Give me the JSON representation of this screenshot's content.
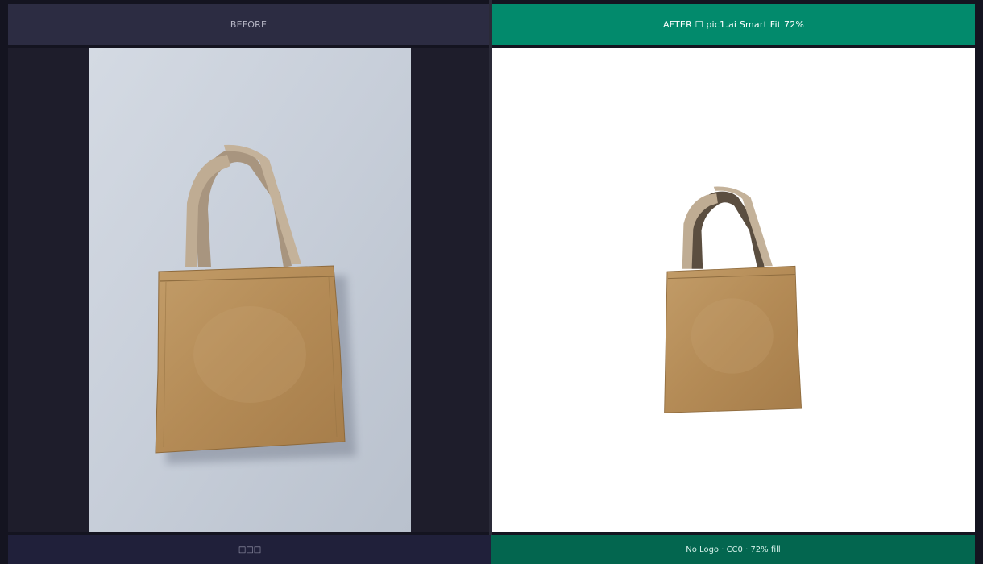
{
  "before": {
    "label": "BEFORE",
    "footer_text": "□□□",
    "photo_subject": "tote-bag-photo"
  },
  "after": {
    "label": "AFTER ☐ pic1.ai  Smart Fit 72%",
    "footer_text": "No Logo · CC0 · 72% fill",
    "photo_subject": "tote-bag-cutout",
    "fill": 0.72
  },
  "colors": {
    "before_header_bg": "#2c2c42",
    "after_header_bg": "#028a6c",
    "after_footer_bg": "#03664f",
    "bag": "#b8915e",
    "handle": "#b7a48d",
    "backdrop": "#c8d0dc"
  }
}
